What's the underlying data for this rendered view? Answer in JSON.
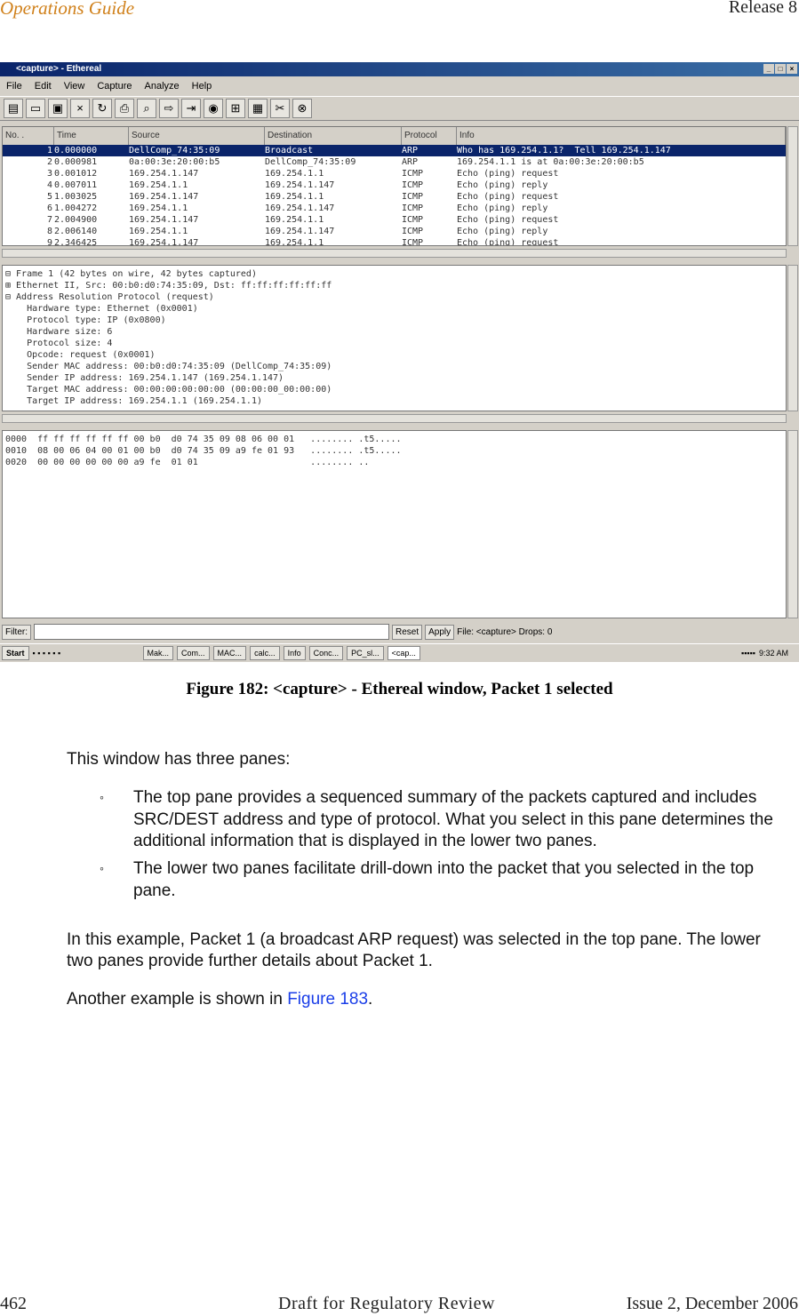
{
  "header": {
    "left": "Operations Guide",
    "right": "Release 8"
  },
  "window": {
    "title": "<capture> - Ethereal",
    "menu": [
      "File",
      "Edit",
      "View",
      "Capture",
      "Analyze",
      "Help"
    ],
    "columns": [
      "No. .",
      "Time",
      "Source",
      "Destination",
      "Protocol",
      "Info"
    ],
    "packets": [
      [
        "1",
        "0.000000",
        "DellComp_74:35:09",
        "Broadcast",
        "ARP",
        "Who has 169.254.1.1?  Tell 169.254.1.147"
      ],
      [
        "2",
        "0.000981",
        "0a:00:3e:20:00:b5",
        "DellComp_74:35:09",
        "ARP",
        "169.254.1.1 is at 0a:00:3e:20:00:b5"
      ],
      [
        "3",
        "0.001012",
        "169.254.1.147",
        "169.254.1.1",
        "ICMP",
        "Echo (ping) request"
      ],
      [
        "4",
        "0.007011",
        "169.254.1.1",
        "169.254.1.147",
        "ICMP",
        "Echo (ping) reply"
      ],
      [
        "5",
        "1.003025",
        "169.254.1.147",
        "169.254.1.1",
        "ICMP",
        "Echo (ping) request"
      ],
      [
        "6",
        "1.004272",
        "169.254.1.1",
        "169.254.1.147",
        "ICMP",
        "Echo (ping) reply"
      ],
      [
        "7",
        "2.004900",
        "169.254.1.147",
        "169.254.1.1",
        "ICMP",
        "Echo (ping) request"
      ],
      [
        "8",
        "2.006140",
        "169.254.1.1",
        "169.254.1.147",
        "ICMP",
        "Echo (ping) reply"
      ],
      [
        "9",
        "2.346425",
        "169.254.1.147",
        "169.254.1.1",
        "ICMP",
        "Echo (ping) request"
      ]
    ],
    "details": [
      "⊟ Frame 1 (42 bytes on wire, 42 bytes captured)",
      "⊞ Ethernet II, Src: 00:b0:d0:74:35:09, Dst: ff:ff:ff:ff:ff:ff",
      "⊟ Address Resolution Protocol (request)",
      "    Hardware type: Ethernet (0x0001)",
      "    Protocol type: IP (0x0800)",
      "    Hardware size: 6",
      "    Protocol size: 4",
      "    Opcode: request (0x0001)",
      "    Sender MAC address: 00:b0:d0:74:35:09 (DellComp_74:35:09)",
      "    Sender IP address: 169.254.1.147 (169.254.1.147)",
      "    Target MAC address: 00:00:00:00:00:00 (00:00:00_00:00:00)",
      "    Target IP address: 169.254.1.1 (169.254.1.1)"
    ],
    "hex": [
      "0000  ff ff ff ff ff ff 00 b0  d0 74 35 09 08 06 00 01   ........ .t5.....",
      "0010  08 00 06 04 00 01 00 b0  d0 74 35 09 a9 fe 01 93   ........ .t5.....",
      "0020  00 00 00 00 00 00 a9 fe  01 01                     ........ .."
    ],
    "filter": {
      "label": "Filter:",
      "value": "",
      "reset": "Reset",
      "apply": "Apply",
      "status": "File: <capture> Drops: 0"
    },
    "taskbar": {
      "start": "Start",
      "items": [
        "Mak...",
        "Com...",
        "MAC...",
        "calc...",
        "Info",
        "Conc...",
        "PC_sl...",
        "<cap..."
      ],
      "clock": "9:32 AM"
    }
  },
  "caption": "Figure 182: <capture> - Ethereal window, Packet 1 selected",
  "intro": "This window has three panes:",
  "bullets": [
    "The top pane provides a sequenced summary of the packets captured and includes SRC/DEST address and type of protocol.  What you select in this pane determines the additional information that is displayed in the lower two panes.",
    "The lower two panes facilitate drill-down into the packet that you selected in the top pane."
  ],
  "bullet_glyph": "◦",
  "example": "In this example, Packet 1 (a broadcast ARP request) was selected in the top pane. The lower two panes provide further details about Packet 1.",
  "another": {
    "before": "Another example is shown in ",
    "link": "Figure 183",
    "after": "."
  },
  "footer": {
    "page": "462",
    "center": "Draft for Regulatory Review",
    "right": "Issue 2, December 2006"
  }
}
